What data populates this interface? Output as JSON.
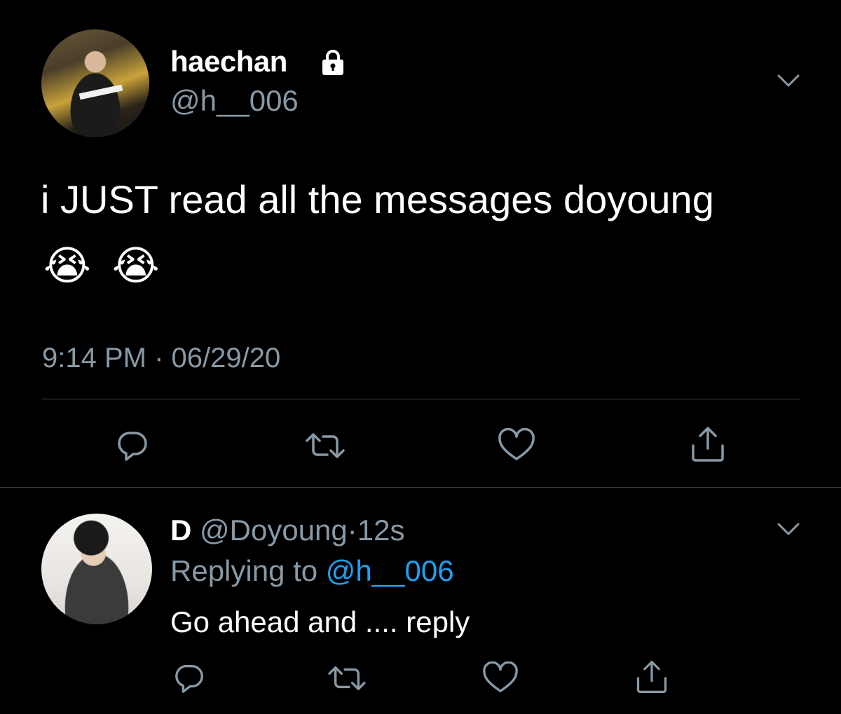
{
  "tweet": {
    "display_name": "haechan",
    "handle": "@h__006",
    "text": "i JUST read all the messages doyoung",
    "emojis": [
      "😭",
      "😭"
    ],
    "timestamp": "9:14 PM · 06/29/20",
    "avatar_icon": "profile-photo",
    "protected_icon": "lock-icon",
    "menu_icon": "chevron-down-icon"
  },
  "actions": [
    "reply-icon",
    "retweet-icon",
    "like-icon",
    "share-icon"
  ],
  "reply": {
    "display_name": "D",
    "handle": "@Doyoung",
    "separator": "·",
    "time": "12s",
    "replying_prefix": "Replying to",
    "replying_to": "@h__006",
    "text": "Go ahead and .... reply",
    "avatar_icon": "profile-photo",
    "menu_icon": "chevron-down-icon"
  },
  "colors": {
    "background": "#000000",
    "text": "#ffffff",
    "secondary": "#8899a6",
    "link": "#1da1f2",
    "divider": "#38444d"
  }
}
